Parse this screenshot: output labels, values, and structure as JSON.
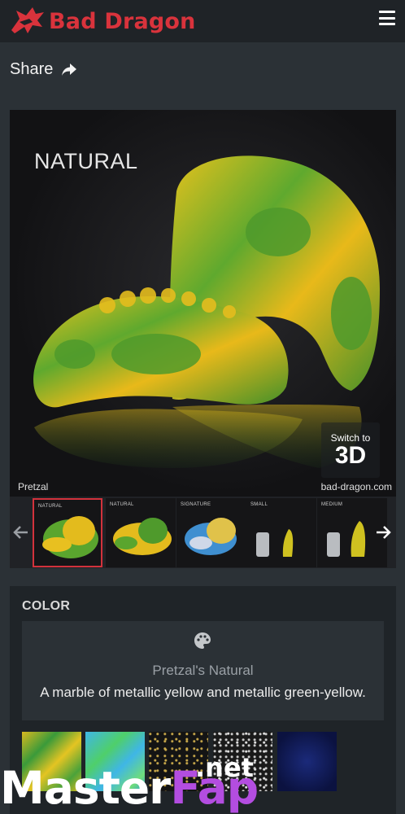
{
  "header": {
    "brand": "Bad Dragon",
    "brand_color": "#d9333c",
    "logo_icon": "dragon-logo-icon",
    "menu_icon": "hamburger-menu-icon"
  },
  "share": {
    "label": "Share",
    "icon": "share-arrow-icon"
  },
  "gallery": {
    "variant_title": "NATURAL",
    "credit_left": "Pretzal",
    "credit_right": "bad-dragon.com",
    "switch3d_top": "Switch to",
    "switch3d_big": "3D",
    "thumbnails": [
      {
        "label": "NATURAL",
        "active": true
      },
      {
        "label": "NATURAL",
        "active": false
      },
      {
        "label": "SIGNATURE",
        "active": false
      },
      {
        "label": "SMALL",
        "active": false
      },
      {
        "label": "MEDIUM",
        "active": false
      }
    ],
    "prev_icon": "arrow-left-icon",
    "next_icon": "arrow-right-icon"
  },
  "color": {
    "heading": "COLOR",
    "icon": "palette-icon",
    "name": "Pretzal's Natural",
    "description": "A marble of metallic yellow and metallic green-yellow.",
    "swatches": [
      {
        "name": "yellow-green marble",
        "colors": [
          "#d8b81f",
          "#3a9a3a"
        ]
      },
      {
        "name": "blue-green marble",
        "colors": [
          "#3fb6e6",
          "#4fcf6a"
        ]
      },
      {
        "name": "black glitter",
        "colors": [
          "#141414",
          "#c9a94a"
        ]
      },
      {
        "name": "black silver glitter",
        "colors": [
          "#1a1a1a",
          "#cfcfcf"
        ]
      },
      {
        "name": "dark blue",
        "colors": [
          "#0b1240",
          "#1b2a7a"
        ]
      }
    ]
  },
  "watermark": {
    "net": ".net",
    "part1": "Master",
    "part2": "Fap"
  }
}
